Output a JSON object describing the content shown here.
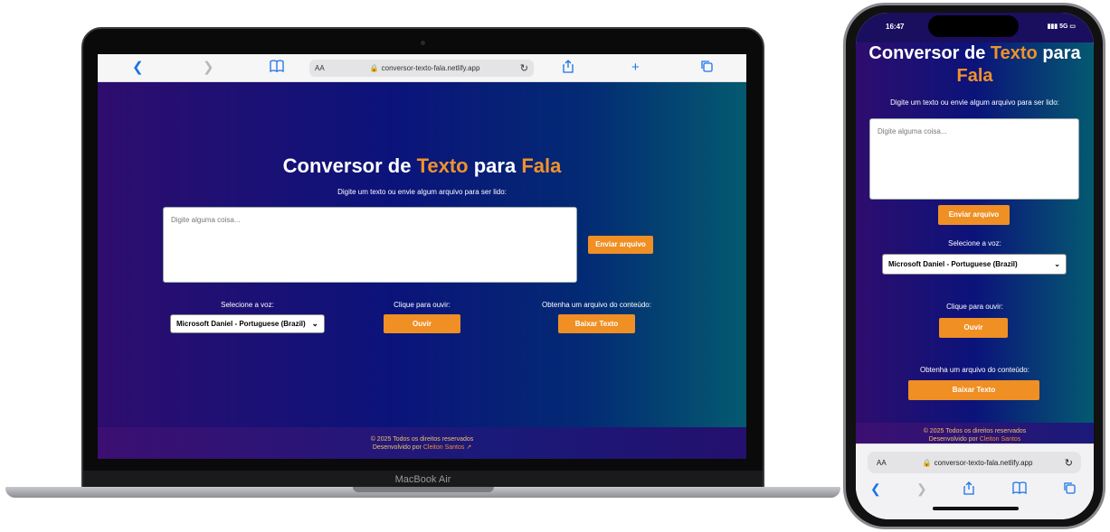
{
  "laptop": {
    "model_label": "MacBook Air",
    "browser": {
      "text_size_label": "AA",
      "url": "conversor-texto-fala.netlify.app",
      "icons": [
        "back-icon",
        "forward-icon",
        "bookmarks-icon",
        "lock-icon",
        "reload-icon",
        "share-icon",
        "new-tab-icon",
        "tabs-icon"
      ]
    }
  },
  "phone": {
    "time": "16:47",
    "signal": "5G",
    "browser": {
      "text_size_label": "AA",
      "url": "conversor-texto-fala.netlify.app"
    }
  },
  "app": {
    "title_part1": "Conversor de ",
    "title_highlight1": "Texto",
    "title_part2": " para ",
    "title_highlight2": "Fala",
    "subtitle": "Digite um texto ou envie algum arquivo para ser lido:",
    "textarea_placeholder": "Digite alguma coisa...",
    "upload_button": "Enviar arquivo",
    "voice_label": "Selecione a voz:",
    "voice_selected": "Microsoft Daniel - Portuguese (Brazil)",
    "listen_label": "Clique para ouvir:",
    "listen_button": "Ouvir",
    "download_label": "Obtenha um arquivo do conteúdo:",
    "download_button": "Baixar Texto",
    "footer_rights": "© 2025 Todos os direitos reservados",
    "footer_dev_prefix": "Desenvolvido por ",
    "footer_dev_name": "Cleiton Santos",
    "accent_color": "#ef8f24"
  }
}
